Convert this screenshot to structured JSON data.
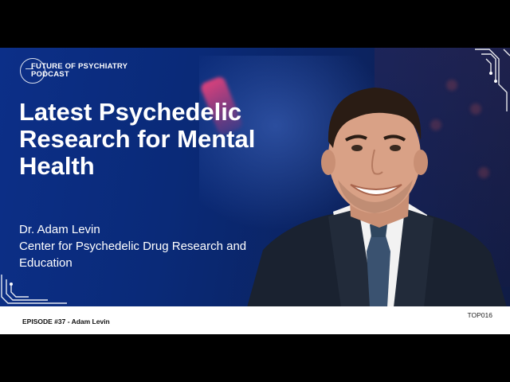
{
  "podcast": {
    "name_line1": "FUTURE OF PSYCHIATRY",
    "name_line2": "PODCAST",
    "logo_icon": "circle-logo-icon"
  },
  "episode": {
    "title_line1": "Latest Psychedelic",
    "title_line2": "Research for Mental",
    "title_line3": "Health",
    "guest_name": "Dr. Adam Levin",
    "affiliation_line1": "Center for Psychedelic Drug Research and",
    "affiliation_line2": "Education",
    "footer_label": "EPISODE #37 - Adam Levin",
    "code": "TOP016"
  },
  "colors": {
    "background": "#0b2a7a",
    "text": "#ffffff",
    "bar": "#ffffff",
    "letterbox": "#000000"
  }
}
